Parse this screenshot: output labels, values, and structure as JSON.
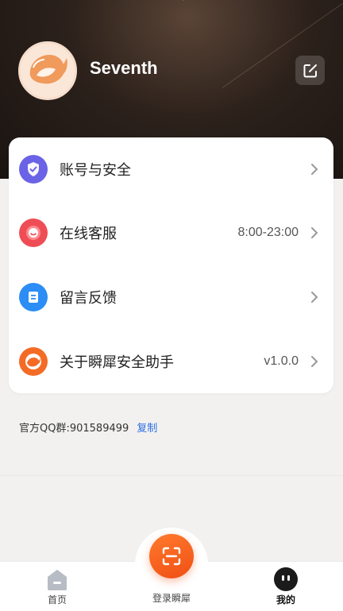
{
  "profile": {
    "username": "Seventh",
    "edit_icon": "edit-icon"
  },
  "menu": {
    "items": [
      {
        "label": "账号与安全",
        "value": "",
        "icon": "shield-icon",
        "color": "#6a63e6"
      },
      {
        "label": "在线客服",
        "value": "8:00-23:00",
        "icon": "service-icon",
        "color": "#ef4d55"
      },
      {
        "label": "留言反馈",
        "value": "",
        "icon": "feedback-icon",
        "color": "#2b8df5"
      },
      {
        "label": "关于瞬犀安全助手",
        "value": "v1.0.0",
        "icon": "rhino-logo-icon",
        "color": "#f36b25"
      }
    ]
  },
  "qq_group": {
    "text": "官方QQ群:901589499",
    "copy_label": "复制"
  },
  "tabbar": {
    "home_label": "首页",
    "login_label": "登录瞬犀",
    "me_label": "我的"
  },
  "colors": {
    "accent": "#f15a1d",
    "link": "#2f6fe0"
  }
}
